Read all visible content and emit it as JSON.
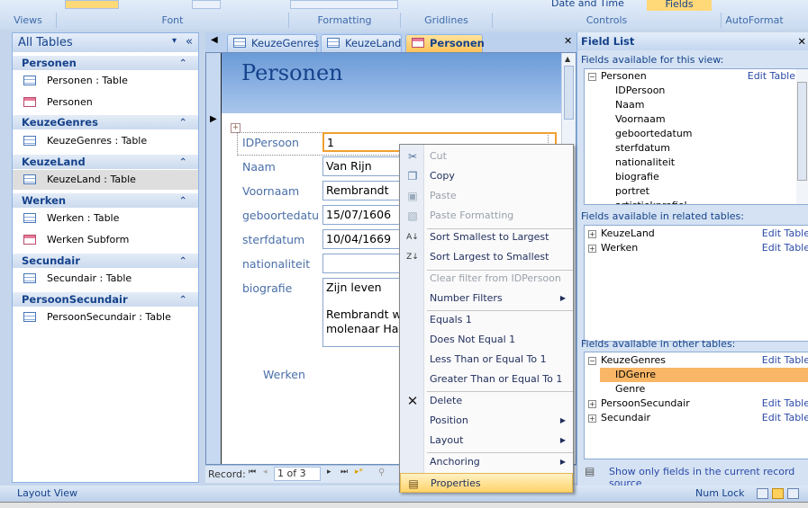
{
  "ribbon": {
    "groups": [
      "Views",
      "Font",
      "Formatting",
      "Gridlines",
      "Controls",
      "AutoFormat"
    ],
    "controls_date_time": "Date and Time",
    "fields_button": "Fields"
  },
  "nav": {
    "title": "All Tables",
    "groups": [
      {
        "name": "Personen",
        "items": [
          {
            "label": "Personen : Table",
            "type": "table"
          },
          {
            "label": "Personen",
            "type": "form"
          }
        ]
      },
      {
        "name": "KeuzeGenres",
        "items": [
          {
            "label": "KeuzeGenres : Table",
            "type": "table"
          }
        ]
      },
      {
        "name": "KeuzeLand",
        "items": [
          {
            "label": "KeuzeLand : Table",
            "type": "table",
            "selected": true
          }
        ]
      },
      {
        "name": "Werken",
        "items": [
          {
            "label": "Werken : Table",
            "type": "table"
          },
          {
            "label": "Werken Subform",
            "type": "form"
          }
        ]
      },
      {
        "name": "Secundair",
        "items": [
          {
            "label": "Secundair : Table",
            "type": "table"
          }
        ]
      },
      {
        "name": "PersoonSecundair",
        "items": [
          {
            "label": "PersoonSecundair : Table",
            "type": "table"
          }
        ]
      }
    ]
  },
  "tabs": [
    {
      "label": "KeuzeGenres"
    },
    {
      "label": "KeuzeLand"
    },
    {
      "label": "Personen",
      "active": true
    }
  ],
  "form": {
    "title": "Personen",
    "fields": [
      {
        "label": "IDPersoon",
        "value": "1"
      },
      {
        "label": "Naam",
        "value": "Van Rijn"
      },
      {
        "label": "Voornaam",
        "value": "Rembrandt"
      },
      {
        "label": "geboortedatu",
        "value": "15/07/1606"
      },
      {
        "label": "sterfdatum",
        "value": "10/04/1669"
      },
      {
        "label": "nationaliteit",
        "value": ""
      },
      {
        "label": "biografie",
        "value": "Zijn leven",
        "value2": "Rembrandt w",
        "value3": "molenaar Har"
      }
    ],
    "subform_label": "Werken"
  },
  "record_nav": {
    "label": "Record:",
    "current": "1 of 3"
  },
  "context_menu": [
    {
      "label": "Cut",
      "disabled": true,
      "icon": "scissors-icon"
    },
    {
      "label": "Copy",
      "icon": "copy-icon"
    },
    {
      "label": "Paste",
      "disabled": true,
      "icon": "paste-icon"
    },
    {
      "label": "Paste Formatting",
      "disabled": true,
      "icon": "paste-formatting-icon"
    },
    {
      "label": "Sort Smallest to Largest",
      "icon": "sort-ascending-icon"
    },
    {
      "label": "Sort Largest to Smallest",
      "icon": "sort-descending-icon"
    },
    {
      "label": "Clear filter from IDPersoon",
      "disabled": true
    },
    {
      "label": "Number Filters",
      "submenu": true
    },
    {
      "label": "Equals 1"
    },
    {
      "label": "Does Not Equal 1"
    },
    {
      "label": "Less Than or Equal To 1"
    },
    {
      "label": "Greater Than or Equal To 1"
    },
    {
      "label": "Delete",
      "icon": "delete-icon"
    },
    {
      "label": "Position",
      "submenu": true
    },
    {
      "label": "Layout",
      "submenu": true
    },
    {
      "label": "Anchoring",
      "submenu": true
    },
    {
      "label": "Properties",
      "icon": "properties-icon",
      "highlighted": true
    }
  ],
  "field_list": {
    "title": "Field List",
    "section_view": "Fields available for this view:",
    "section_related": "Fields available in related tables:",
    "section_other": "Fields available in other tables:",
    "edit_table": "Edit Table",
    "view_table": "Personen",
    "view_fields": [
      "IDPersoon",
      "Naam",
      "Voornaam",
      "geboortedatum",
      "sterfdatum",
      "nationaliteit",
      "biografie",
      "portret",
      "artistiekprofiel"
    ],
    "related": [
      "KeuzeLand",
      "Werken"
    ],
    "other_expanded": "KeuzeGenres",
    "other_fields": [
      "IDGenre",
      "Genre"
    ],
    "other_selected": "IDGenre",
    "other": [
      "PersoonSecundair",
      "Secundair"
    ],
    "show_only": "Show only fields in the current record source"
  },
  "status": {
    "left": "Layout View",
    "num_lock": "Num Lock"
  },
  "colors": {
    "accent": "#ffc35a",
    "ribbon": "#c9daf0",
    "label": "#4a6fa8"
  }
}
